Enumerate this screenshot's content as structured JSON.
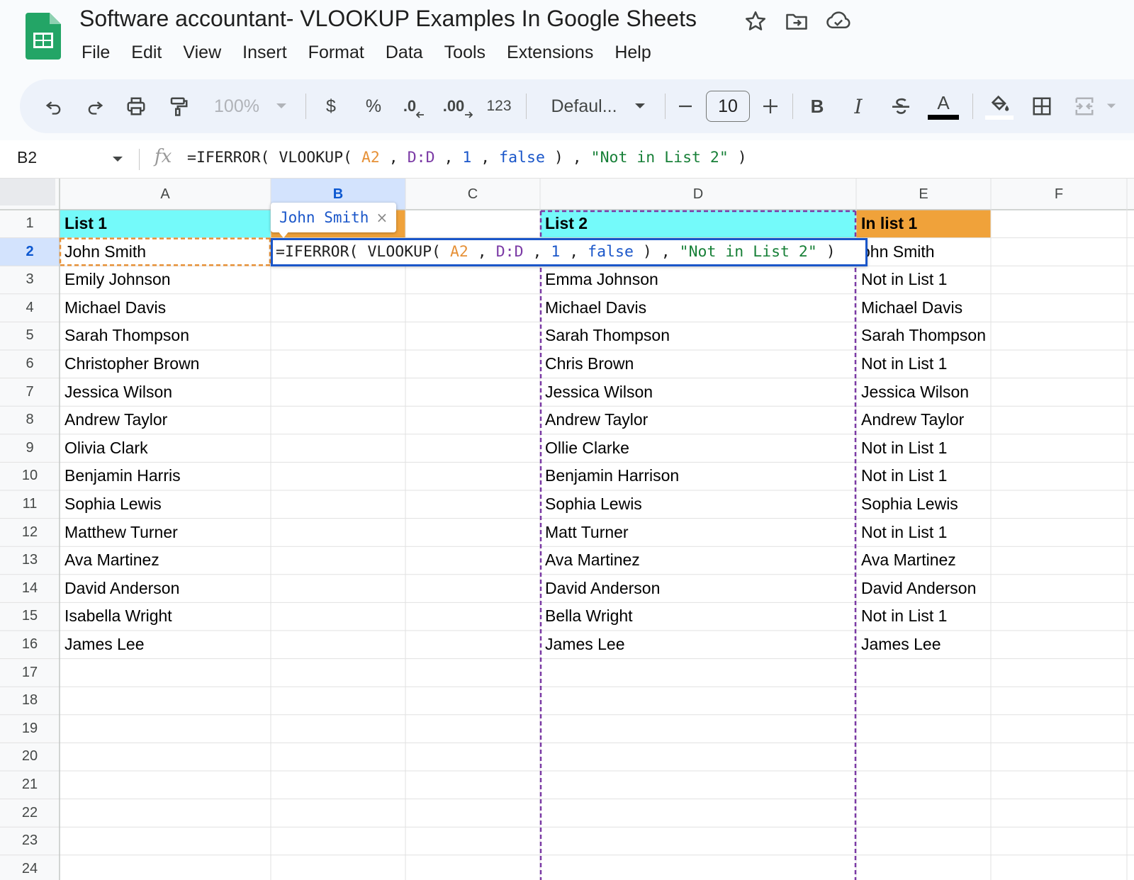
{
  "document": {
    "title": "Software accountant- VLOOKUP Examples In Google Sheets",
    "icons": [
      "star-icon",
      "move-to-folder-icon",
      "cloud-saved-icon"
    ]
  },
  "menu": [
    "File",
    "Edit",
    "View",
    "Insert",
    "Format",
    "Data",
    "Tools",
    "Extensions",
    "Help"
  ],
  "toolbar": {
    "zoom": "100%",
    "currency": "$",
    "percent": "%",
    "decrease_decimal": ".0",
    "increase_decimal": ".00",
    "number_format": "123",
    "font": "Defaul...",
    "font_size": "10",
    "bold": "B",
    "italic": "I",
    "text_color": "A"
  },
  "formula_bar": {
    "name_box": "B2",
    "fx": "fx",
    "formula_parts": [
      "=IFERROR( VLOOKUP( ",
      "A2",
      " , ",
      "D:D",
      " , ",
      "1",
      " , ",
      "false",
      " ) , ",
      "\"Not in List 2\"",
      " )"
    ]
  },
  "grid": {
    "columns": [
      "A",
      "B",
      "C",
      "D",
      "E",
      "F"
    ],
    "active_column": "B",
    "active_row": 2,
    "rows": [
      "1",
      "2",
      "3",
      "4",
      "5",
      "6",
      "7",
      "8",
      "9",
      "10",
      "11",
      "12",
      "13",
      "14",
      "15",
      "16",
      "17",
      "18",
      "19",
      "20",
      "21",
      "22",
      "23",
      "24"
    ],
    "header_colors": {
      "A": "#74fafa",
      "B": "#f0a23a",
      "D": "#74fafa",
      "E": "#f0a23a"
    },
    "colA": [
      "List 1",
      "John Smith",
      "Emily Johnson",
      "Michael Davis",
      "Sarah Thompson",
      "Christopher Brown",
      "Jessica Wilson",
      "Andrew Taylor",
      "Olivia Clark",
      "Benjamin Harris",
      "Sophia Lewis",
      "Matthew Turner",
      "Ava Martinez",
      "David Anderson",
      "Isabella Wright",
      "James Lee"
    ],
    "colD": [
      "List 2",
      "",
      "Emma Johnson",
      "Michael Davis",
      "Sarah Thompson",
      "Chris Brown",
      "Jessica Wilson",
      "Andrew Taylor",
      "Ollie Clarke",
      "Benjamin Harrison",
      "Sophia Lewis",
      "Matt Turner",
      "Ava Martinez",
      "David Anderson",
      "Bella Wright",
      "James Lee"
    ],
    "colE": [
      "In list 1",
      "ohn Smith",
      "Not in List 1",
      "Michael Davis",
      "Sarah Thompson",
      "Not in List 1",
      "Jessica Wilson",
      "Andrew Taylor",
      "Not in List 1",
      "Not in List 1",
      "Sophia Lewis",
      "Not in List 1",
      "Ava Martinez",
      "David Anderson",
      "Not in List 1",
      "James Lee"
    ]
  },
  "editor": {
    "chip_text": "John Smith",
    "chip_close": "×"
  },
  "colors": {
    "accent_blue": "#1a56c9",
    "ref_orange": "#e69138",
    "ref_purple": "#7b3aa5",
    "string_green": "#188038"
  }
}
